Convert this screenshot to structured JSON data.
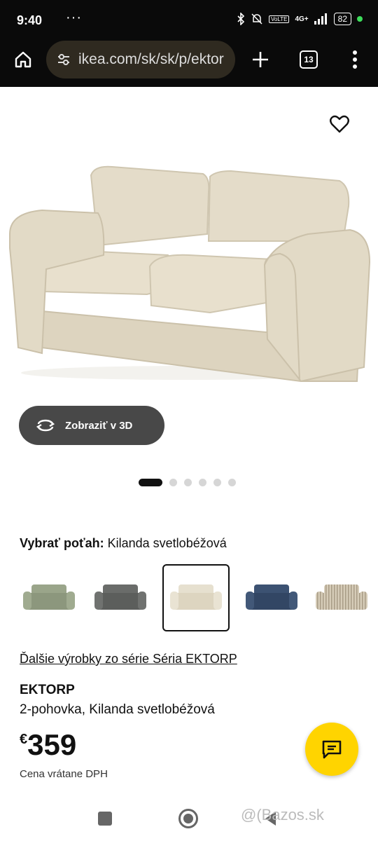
{
  "status": {
    "time": "9:40",
    "more": "···",
    "network": "4G+",
    "battery": "82"
  },
  "browser": {
    "url": "ikea.com/sk/sk/p/ektor",
    "tab_count": "13"
  },
  "view3d": {
    "label": "Zobraziť v 3D"
  },
  "carousel": {
    "total": 6,
    "active": 0
  },
  "color_picker": {
    "label": "Vybrať poťah:",
    "selected_value": "Kilanda svetlobéžová",
    "swatches": [
      {
        "name": "green",
        "color": "#9aa58a"
      },
      {
        "name": "dark-grey",
        "color": "#6a6c6a"
      },
      {
        "name": "light-beige",
        "color": "#e6e0cf",
        "selected": true
      },
      {
        "name": "dark-blue",
        "color": "#3c5272"
      },
      {
        "name": "striped-beige",
        "color": "#cfc4ae"
      }
    ]
  },
  "series_link": "Ďalšie výrobky zo série Séria EKTORP",
  "product": {
    "brand": "EKTORP",
    "description": "2-pohovka, Kilanda svetlobéžová",
    "currency": "€",
    "price": "359",
    "vat_note": "Cena vrátane DPH"
  },
  "watermark": "@(Bazos.sk"
}
